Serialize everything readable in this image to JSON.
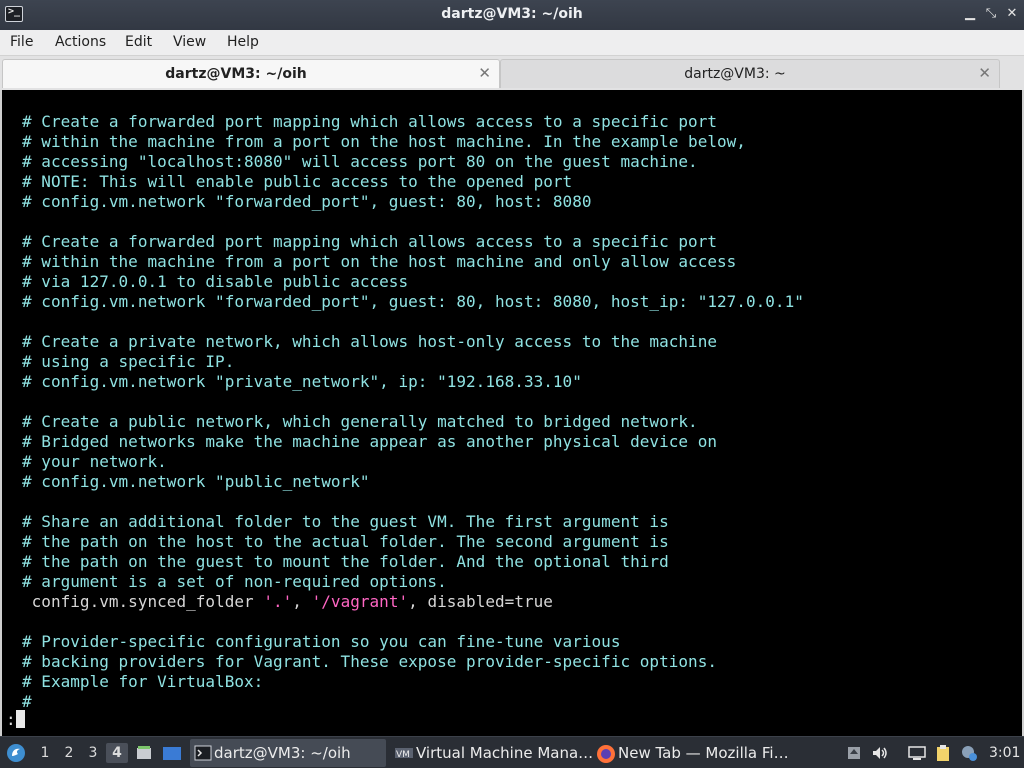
{
  "window": {
    "title": "dartz@VM3: ~/oih"
  },
  "menu": [
    "File",
    "Actions",
    "Edit",
    "View",
    "Help"
  ],
  "tabs": [
    {
      "label": "dartz@VM3: ~/oih",
      "active": true
    },
    {
      "label": "dartz@VM3: ~",
      "active": false
    }
  ],
  "terminal": {
    "lines": [
      "# Create a forwarded port mapping which allows access to a specific port",
      "# within the machine from a port on the host machine. In the example below,",
      "# accessing \"localhost:8080\" will access port 80 on the guest machine.",
      "# NOTE: This will enable public access to the opened port",
      "# config.vm.network \"forwarded_port\", guest: 80, host: 8080",
      "",
      "# Create a forwarded port mapping which allows access to a specific port",
      "# within the machine from a port on the host machine and only allow access",
      "# via 127.0.0.1 to disable public access",
      "# config.vm.network \"forwarded_port\", guest: 80, host: 8080, host_ip: \"127.0.0.1\"",
      "",
      "# Create a private network, which allows host-only access to the machine",
      "# using a specific IP.",
      "# config.vm.network \"private_network\", ip: \"192.168.33.10\"",
      "",
      "# Create a public network, which generally matched to bridged network.",
      "# Bridged networks make the machine appear as another physical device on",
      "# your network.",
      "# config.vm.network \"public_network\"",
      "",
      "# Share an additional folder to the guest VM. The first argument is",
      "# the path on the host to the actual folder. The second argument is",
      "# the path on the guest to mount the folder. And the optional third",
      "# argument is a set of non-required options.",
      "",
      "",
      "# Provider-specific configuration so you can fine-tune various",
      "# backing providers for Vagrant. These expose provider-specific options.",
      "# Example for VirtualBox:",
      "#"
    ],
    "code_line": {
      "prefix": " config.vm.synced_folder ",
      "arg1": "'.'",
      "sep": ", ",
      "arg2": "'/vagrant'",
      "suffix": ", disabled=true"
    },
    "prompt": ":"
  },
  "taskbar": {
    "workspaces": [
      "1",
      "2",
      "3",
      "4"
    ],
    "active_workspace": "4",
    "tasks": [
      {
        "label": "dartz@VM3: ~/oih",
        "icon": "terminal-icon"
      },
      {
        "label": "Virtual Machine Mana…",
        "icon": "virt-manager-icon"
      },
      {
        "label": "New Tab — Mozilla Fi…",
        "icon": "firefox-icon"
      }
    ],
    "clock": "3:01"
  },
  "colors": {
    "comment": "#8fe2e2",
    "string": "#ff66c4",
    "terminal_bg": "#000000"
  }
}
